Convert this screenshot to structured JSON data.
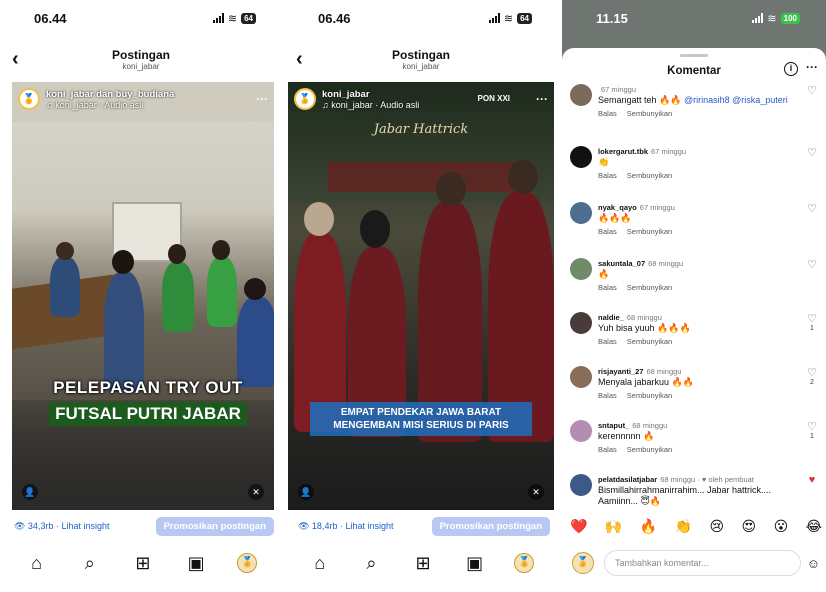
{
  "panel1": {
    "status": {
      "time": "06.44",
      "battery": "64"
    },
    "header": {
      "title": "Postingan",
      "subtitle": "koni_jabar"
    },
    "post": {
      "author": "koni_jabar dan buy_budiana",
      "audio": "♫ koni_jabar · Audio asli",
      "caption_line1": "PELEPASAN TRY OUT",
      "caption_line2": "FUTSAL PUTRI JABAR"
    },
    "views": "👁 34,3rb · Lihat insight",
    "promote_label": "Promosikan postingan"
  },
  "panel2": {
    "status": {
      "time": "06.46",
      "battery": "64"
    },
    "header": {
      "title": "Postingan",
      "subtitle": "koni_jabar"
    },
    "post": {
      "author": "koni_jabar",
      "audio": "♫ koni_jabar · Audio asli",
      "overlay_title": "Jabar Hattrick",
      "event_logo": "PON XXI",
      "caption": "EMPAT PENDEKAR JAWA BARAT MENGEMBAN MISI SERIUS DI PARIS"
    },
    "views": "👁 18,4rb · Lihat insight",
    "promote_label": "Promosikan postingan"
  },
  "panel3": {
    "status": {
      "time": "11.15",
      "battery": "100"
    },
    "title": "Komentar",
    "comments": [
      {
        "user": "",
        "age": "67 minggu",
        "text": "Semangatt teh 🔥🔥 ",
        "mention": "@ririnasih8 @riska_puteri",
        "reply": "Balas",
        "hide": "Sembunyikan",
        "likes": ""
      },
      {
        "user": "lokergarut.tbk",
        "age": "67 minggu",
        "text": "👏",
        "mention": "",
        "reply": "Balas",
        "hide": "Sembunyikan",
        "likes": ""
      },
      {
        "user": "nyak_qayo",
        "age": "67 minggu",
        "text": "🔥🔥🔥",
        "mention": "",
        "reply": "Balas",
        "hide": "Sembunyikan",
        "likes": ""
      },
      {
        "user": "sakuntala_07",
        "age": "68 minggu",
        "text": "🔥",
        "mention": "",
        "reply": "Balas",
        "hide": "Sembunyikan",
        "likes": ""
      },
      {
        "user": "naldie_",
        "age": "68 minggu",
        "text": "Yuh bisa yuuh 🔥🔥🔥",
        "mention": "",
        "reply": "Balas",
        "hide": "Sembunyikan",
        "likes": "1"
      },
      {
        "user": "risjayanti_27",
        "age": "68 minggu",
        "text": "Menyala jabarkuu 🔥🔥",
        "mention": "",
        "reply": "Balas",
        "hide": "Sembunyikan",
        "likes": "2"
      },
      {
        "user": "sntaput_",
        "age": "68 minggu",
        "text": "kerennnnn 🔥",
        "mention": "",
        "reply": "Balas",
        "hide": "Sembunyikan",
        "likes": "1"
      },
      {
        "user": "pelatdasilatjabar",
        "age": "68 minggu · ♥ oleh pembuat",
        "text": "Bismillahirrahmanirrahim... Jabar hattrick.... Aamiinn... 😇🔥",
        "mention": "",
        "reply": "",
        "hide": "",
        "likes": ""
      }
    ],
    "reactions": [
      "❤️",
      "🙌",
      "🔥",
      "👏",
      "😢",
      "😍",
      "😮",
      "😂"
    ],
    "input_placeholder": "Tambahkan komentar..."
  }
}
